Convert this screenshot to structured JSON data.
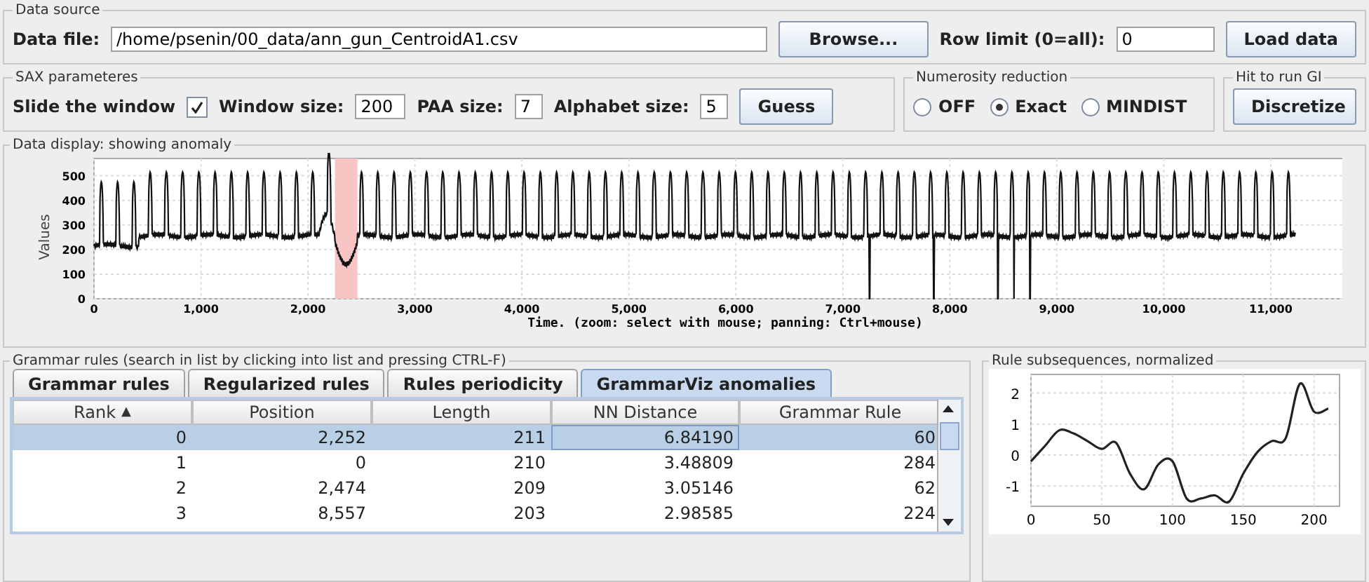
{
  "data_source": {
    "title": "Data source",
    "file_label": "Data file:",
    "file_value": "/home/psenin/00_data/ann_gun_CentroidA1.csv",
    "browse": "Browse...",
    "row_limit_label": "Row limit (0=all):",
    "row_limit_value": "0",
    "load": "Load data"
  },
  "sax": {
    "title": "SAX parameteres",
    "slide_label": "Slide the window",
    "slide_checked": true,
    "window_label": "Window size:",
    "window_value": "200",
    "paa_label": "PAA size:",
    "paa_value": "7",
    "alphabet_label": "Alphabet size:",
    "alphabet_value": "5",
    "guess": "Guess"
  },
  "numerosity": {
    "title": "Numerosity reduction",
    "options": [
      {
        "label": "OFF",
        "selected": false
      },
      {
        "label": "Exact",
        "selected": true
      },
      {
        "label": "MINDIST",
        "selected": false
      }
    ]
  },
  "run": {
    "title": "Hit to run GI",
    "button": "Discretize"
  },
  "display": {
    "title": "Data display: showing anomaly",
    "ylabel": "Values",
    "xlabel": "Time. (zoom: select with mouse; panning: Ctrl+mouse)",
    "xtick_labels": [
      "0",
      "1,000",
      "2,000",
      "3,000",
      "4,000",
      "5,000",
      "6,000",
      "7,000",
      "8,000",
      "9,000",
      "10,000",
      "11,000"
    ],
    "ytick_labels": [
      "500",
      "400",
      "300",
      "200",
      "100",
      "0"
    ]
  },
  "rules": {
    "title": "Grammar rules (search in list by clicking into list and pressing CTRL-F)",
    "tabs": [
      {
        "label": "Grammar rules",
        "selected": false
      },
      {
        "label": "Regularized rules",
        "selected": false
      },
      {
        "label": "Rules periodicity",
        "selected": false
      },
      {
        "label": "GrammarViz anomalies",
        "selected": true
      }
    ],
    "columns": [
      {
        "label": "Rank",
        "sort": "▲"
      },
      {
        "label": "Position"
      },
      {
        "label": "Length"
      },
      {
        "label": "NN Distance"
      },
      {
        "label": "Grammar Rule"
      }
    ],
    "rows": [
      {
        "cells": [
          "0",
          "2,252",
          "211",
          "6.84190",
          "60"
        ],
        "selected": true
      },
      {
        "cells": [
          "1",
          "0",
          "210",
          "3.48809",
          "284"
        ],
        "selected": false
      },
      {
        "cells": [
          "2",
          "2,474",
          "209",
          "3.05146",
          "62"
        ],
        "selected": false
      },
      {
        "cells": [
          "3",
          "8,557",
          "203",
          "2.98585",
          "224"
        ],
        "selected": false
      }
    ]
  },
  "subsequence": {
    "title": "Rule subsequences, normalized",
    "chart_data": {
      "type": "line",
      "grid": true,
      "xlim": [
        0,
        218
      ],
      "ylim": [
        -1.65,
        2.6
      ],
      "xticks": [
        0,
        50,
        100,
        150,
        200
      ],
      "yticks": [
        -1,
        0,
        1,
        2
      ],
      "x": [
        0,
        10,
        20,
        30,
        40,
        50,
        60,
        70,
        80,
        90,
        100,
        110,
        120,
        130,
        140,
        150,
        160,
        170,
        180,
        190,
        200,
        210
      ],
      "series": [
        {
          "color": "#222222",
          "values": [
            -0.2,
            0.3,
            0.8,
            0.7,
            0.45,
            0.2,
            0.4,
            -0.6,
            -1.1,
            -0.3,
            -0.2,
            -1.4,
            -1.4,
            -1.3,
            -1.5,
            -0.6,
            0.1,
            0.45,
            0.55,
            2.3,
            1.4,
            1.5
          ]
        }
      ]
    }
  }
}
